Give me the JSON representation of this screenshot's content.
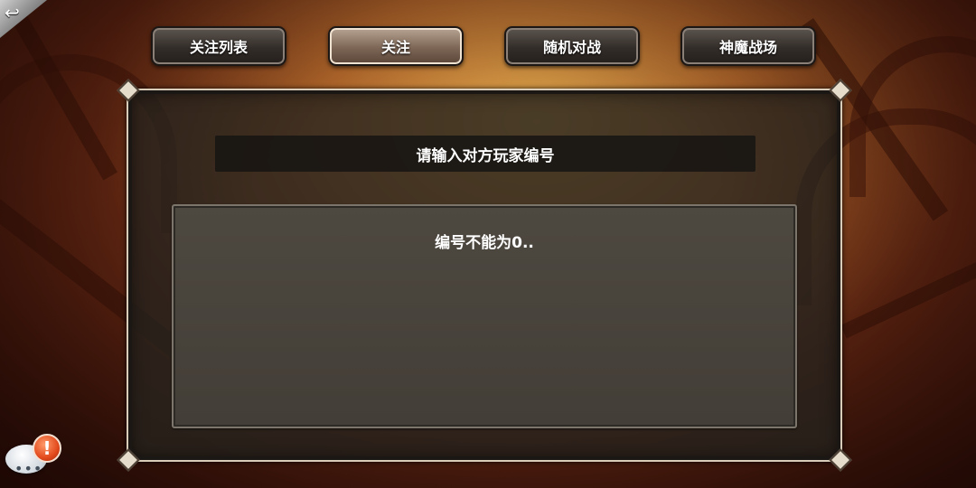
{
  "tabs": [
    {
      "label": "关注列表",
      "active": false
    },
    {
      "label": "关注",
      "active": true
    },
    {
      "label": "随机对战",
      "active": false
    },
    {
      "label": "神魔战场",
      "active": false
    }
  ],
  "back_button": {
    "icon": "return-arrow-icon",
    "glyph": "↩"
  },
  "panel": {
    "title": "请输入对方玩家编号",
    "message": "编号不能为0.."
  },
  "chat": {
    "icon": "chat-bubble-icon",
    "dots": "•••",
    "alert_icon": "alert-badge-icon",
    "alert_glyph": "!"
  },
  "colors": {
    "background_glow": "#d9a24a",
    "panel_border": "#d9ccb8",
    "tab_active": "#b8a594",
    "alert": "#e24a1c"
  }
}
